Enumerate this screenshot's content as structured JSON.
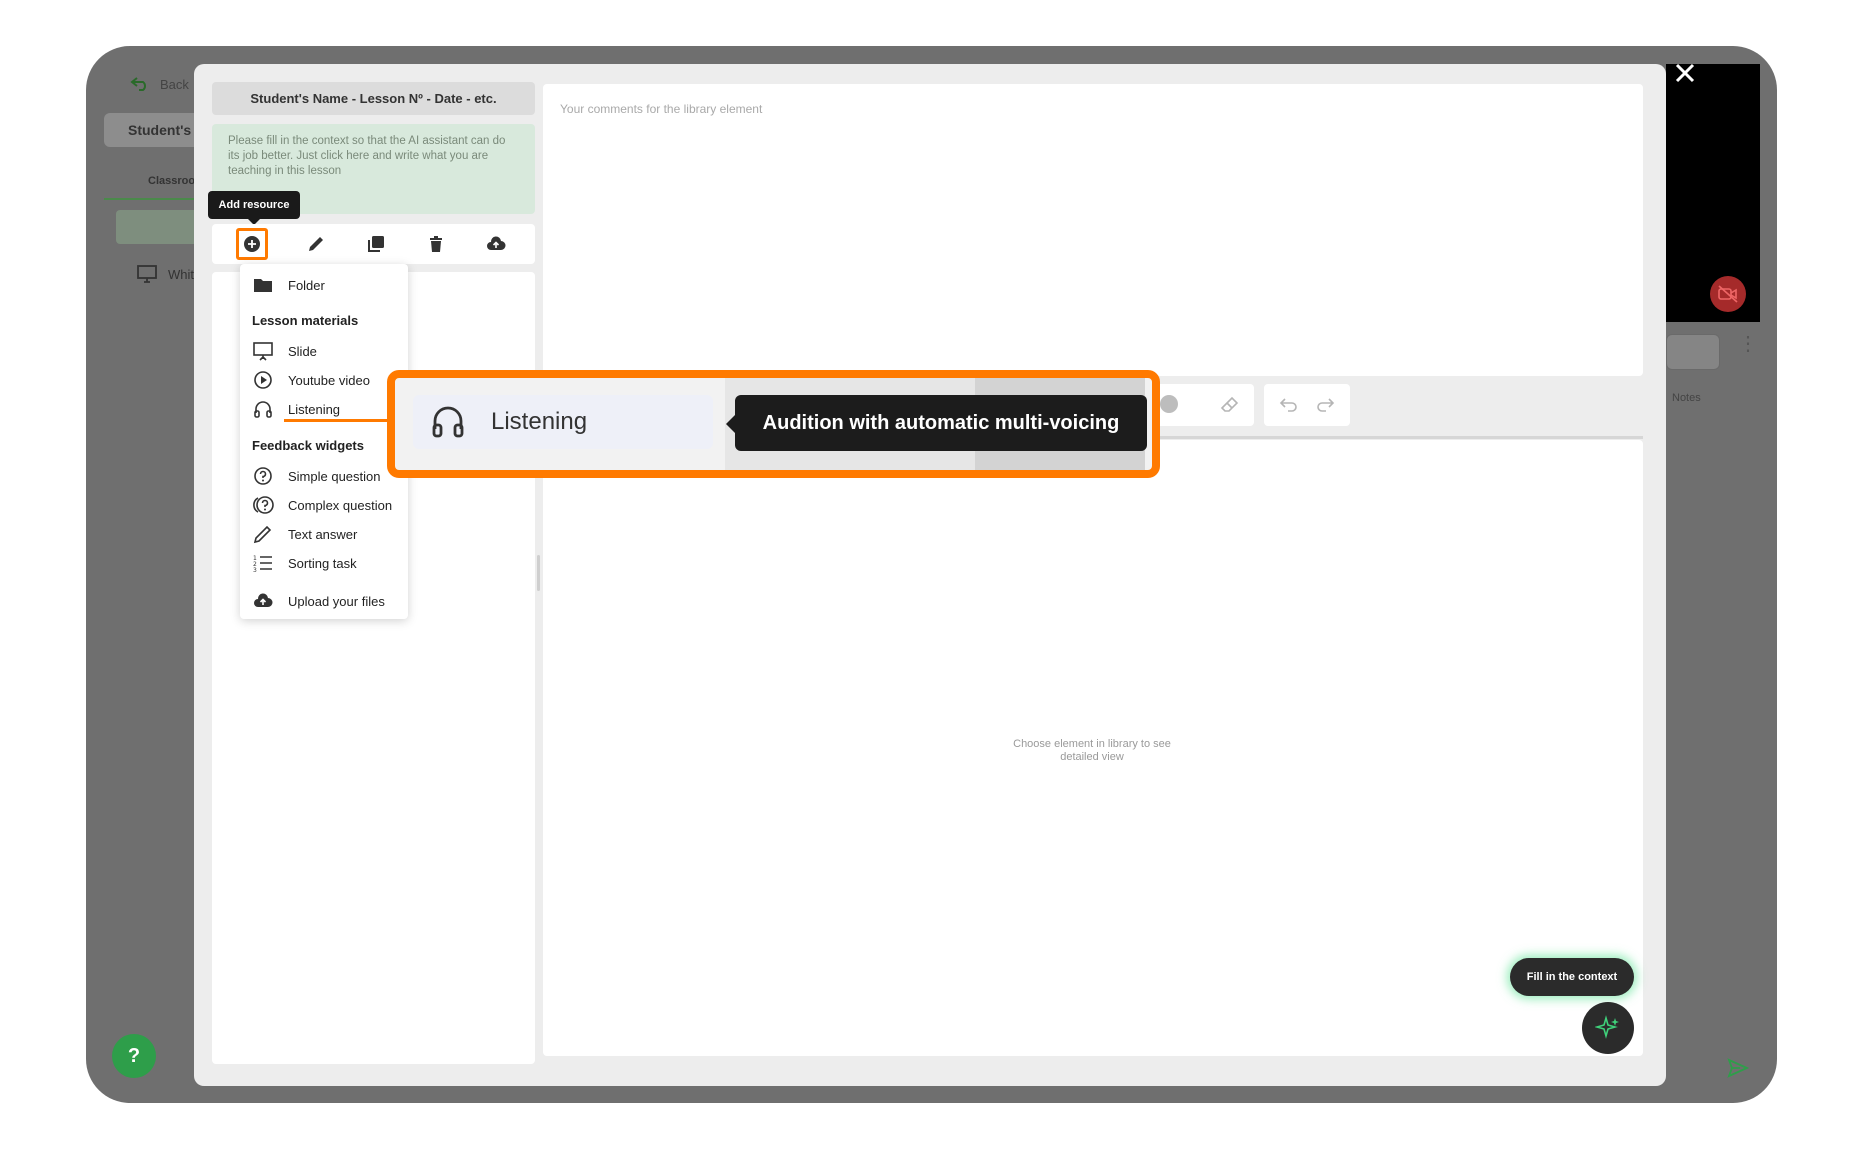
{
  "background_app": {
    "back_label": "Back",
    "student_tab": "Student's N",
    "classroom_tab": "Classroo",
    "whiteboard_label": "Whit",
    "notes_label": "Notes",
    "help_label": "?"
  },
  "modal": {
    "lesson_title": "Student's Name - Lesson Nº - Date - etc.",
    "context_text": "Please fill in the context so that the AI assistant can do its job better. Just click here and write what you are teaching in this lesson",
    "add_resource_tooltip": "Add resource",
    "comments_placeholder": "Your comments for the library element",
    "choose_element_text": "Choose element in library to see detailed view",
    "fill_context_label": "Fill in the context"
  },
  "menu": {
    "folder": "Folder",
    "lesson_materials_heading": "Lesson materials",
    "slide": "Slide",
    "youtube_video": "Youtube video",
    "listening": "Listening",
    "feedback_widgets_heading": "Feedback widgets",
    "simple_question": "Simple question",
    "complex_question": "Complex question",
    "text_answer": "Text answer",
    "sorting_task": "Sorting task",
    "upload_files": "Upload your files"
  },
  "callout": {
    "item_label": "Listening",
    "tooltip": "Audition with automatic multi-voicing"
  },
  "icons": {
    "add": "plus-circle-icon",
    "edit": "pencil-icon",
    "duplicate": "copy-icon",
    "delete": "trash-icon",
    "upload": "cloud-upload-icon"
  },
  "colors": {
    "highlight": "#ff7a00",
    "help_button": "#2e9e4a",
    "dark": "#1c1c1c"
  }
}
